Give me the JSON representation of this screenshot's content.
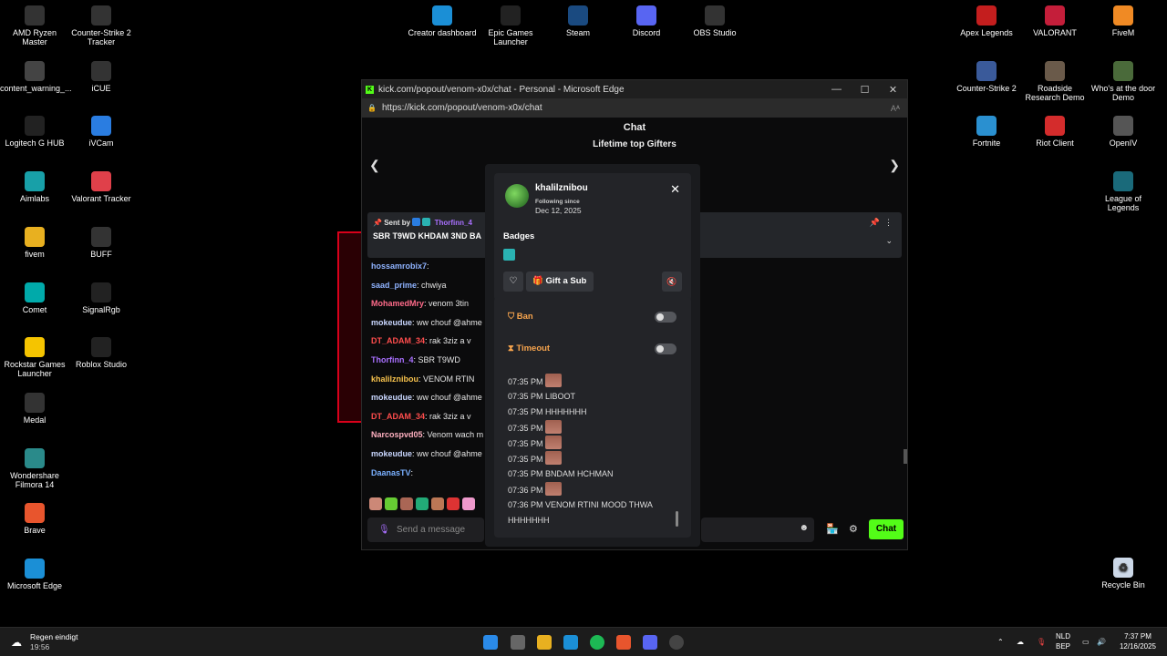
{
  "desktop": {
    "left_icons": [
      {
        "label": "AMD Ryzen Master",
        "color": "#333"
      },
      {
        "label": "content_warning_...",
        "color": "#444"
      },
      {
        "label": "Logitech G HUB",
        "color": "#222"
      },
      {
        "label": "Aimlabs",
        "color": "#18a0a8"
      },
      {
        "label": "fivem",
        "color": "#e8b020"
      },
      {
        "label": "Comet",
        "color": "#0aa"
      },
      {
        "label": "Rockstar Games Launcher",
        "color": "#f5c400"
      },
      {
        "label": "Medal",
        "color": "#333"
      },
      {
        "label": "Wondershare Filmora 14",
        "color": "#2a8a8a"
      },
      {
        "label": "Brave",
        "color": "#e8552d"
      },
      {
        "label": "Microsoft Edge",
        "color": "#1b8fd6"
      }
    ],
    "left_icons_col2": [
      {
        "label": "Counter-Strike 2 Tracker",
        "color": "#333"
      },
      {
        "label": "iCUE",
        "color": "#333"
      },
      {
        "label": "iVCam",
        "color": "#2a7de1"
      },
      {
        "label": "Valorant Tracker",
        "color": "#e0404a"
      },
      {
        "label": "BUFF",
        "color": "#333"
      },
      {
        "label": "SignalRgb",
        "color": "#222"
      },
      {
        "label": "Roblox Studio",
        "color": "#222"
      }
    ],
    "top_icons": [
      {
        "label": "Creator dashboard",
        "color": "#1b8fd6"
      },
      {
        "label": "Epic Games Launcher",
        "color": "#222"
      },
      {
        "label": "Steam",
        "color": "#1a4a80"
      },
      {
        "label": "Discord",
        "color": "#5865f2"
      },
      {
        "label": "OBS Studio",
        "color": "#333"
      }
    ],
    "right_icons_col1": [
      {
        "label": "Apex Legends",
        "color": "#c41e1e"
      },
      {
        "label": "Counter-Strike 2",
        "color": "#3a5a9a"
      },
      {
        "label": "Fortnite",
        "color": "#2a90d0"
      }
    ],
    "right_icons_col2": [
      {
        "label": "VALORANT",
        "color": "#c41e3a"
      },
      {
        "label": "Roadside Research Demo",
        "color": "#6a5a4a"
      },
      {
        "label": "Riot Client",
        "color": "#d42c2c"
      }
    ],
    "right_icons_col3": [
      {
        "label": "FiveM",
        "color": "#f08a24"
      },
      {
        "label": "Who's at the door Demo",
        "color": "#4a6a3a"
      },
      {
        "label": "OpenIV",
        "color": "#555"
      },
      {
        "label": "League of Legends",
        "color": "#1a6a7a"
      }
    ],
    "recycle_bin": "Recycle Bin"
  },
  "browser": {
    "title": "kick.com/popout/venom-x0x/chat - Personal - Microsoft Edge",
    "url": "https://kick.com/popout/venom-x0x/chat",
    "chat_header": "Chat",
    "gifters_title": "Lifetime top Gifters",
    "pinned": {
      "sent_by_label": "Sent by",
      "sender": "Thorfinn_4",
      "text": "SBR T9WD KHDAM 3ND BA"
    },
    "messages": [
      {
        "user": "hossamrobix7",
        "text": "",
        "color": "#8fb3ff"
      },
      {
        "user": "saad_prime",
        "text": "chwiya",
        "color": "#8fb3ff"
      },
      {
        "user": "MohamedMry",
        "text": "venom 3tin",
        "color": "#ff6b8a"
      },
      {
        "user": "mokeudue",
        "text": "ww chouf @ahme",
        "color": "#c9d7ff"
      },
      {
        "user": "DT_ADAM_34",
        "text": "rak 3ziz a v",
        "color": "#ff4d4d"
      },
      {
        "user": "Thorfinn_4",
        "text": "SBR T9WD",
        "color": "#a970ff"
      },
      {
        "user": "khalilznibou",
        "text": "VENOM RTIN",
        "color": "#f7c24d"
      },
      {
        "user": "mokeudue",
        "text": "ww chouf @ahme",
        "color": "#c9d7ff"
      },
      {
        "user": "DT_ADAM_34",
        "text": "rak 3ziz a v",
        "color": "#ff4d4d"
      },
      {
        "user": "Narcospvd05",
        "text": "Venom wach m",
        "color": "#ffb0c0"
      },
      {
        "user": "mokeudue",
        "text": "ww chouf @ahme",
        "color": "#c9d7ff"
      },
      {
        "user": "DaanasTV",
        "text": "",
        "color": "#7ab0ff"
      }
    ],
    "send_placeholder": "Send a message",
    "chat_button": "Chat"
  },
  "user_card": {
    "username": "khalilznibou",
    "following_since_label": "Following since",
    "following_since_date": "Dec 12, 2025",
    "badges_label": "Badges",
    "gift_button": "Gift a Sub",
    "ban_label": "Ban",
    "timeout_label": "Timeout",
    "history": [
      {
        "time": "07:35 PM",
        "text": "",
        "emote": true
      },
      {
        "time": "07:35 PM",
        "text": "LIBOOT",
        "emote": false
      },
      {
        "time": "07:35 PM",
        "text": "HHHHHHH",
        "emote": false
      },
      {
        "time": "07:35 PM",
        "text": "",
        "emote": true
      },
      {
        "time": "07:35 PM",
        "text": "",
        "emote": true
      },
      {
        "time": "07:35 PM",
        "text": "",
        "emote": true
      },
      {
        "time": "07:35 PM",
        "text": "BNDAM HCHMAN",
        "emote": false
      },
      {
        "time": "07:36 PM",
        "text": "",
        "emote": true
      },
      {
        "time": "07:36 PM",
        "text": "VENOM RTINI MOOD THWA",
        "emote": false
      },
      {
        "time": "",
        "text": "HHHHHHH",
        "emote": false
      }
    ]
  },
  "taskbar": {
    "weather_line1": "Regen eindigt",
    "weather_line2": "19:56",
    "lang_line1": "NLD",
    "lang_line2": "BEP",
    "time": "7:37 PM",
    "date": "12/16/2025"
  }
}
